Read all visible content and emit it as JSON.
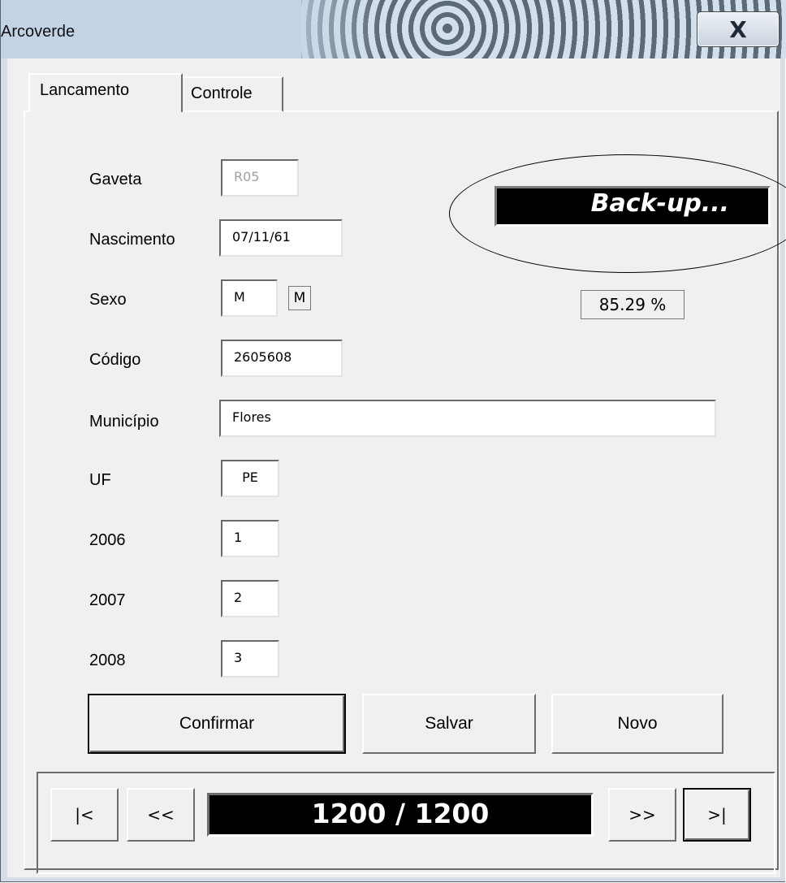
{
  "window": {
    "title": "Arcoverde",
    "close_symbol": "X"
  },
  "tabs": [
    {
      "label": "Lancamento",
      "active": true
    },
    {
      "label": "Controle",
      "active": false
    }
  ],
  "status": {
    "backup_text": "Back-up...",
    "progress_text": "85.29 %"
  },
  "form": {
    "gaveta": {
      "label": "Gaveta",
      "value": "R05"
    },
    "nascimento": {
      "label": "Nascimento",
      "value": "07/11/61"
    },
    "sexo": {
      "label": "Sexo",
      "value": "M",
      "display": "M"
    },
    "codigo": {
      "label": "Código",
      "value": "2605608"
    },
    "municipio": {
      "label": "Município",
      "value": "Flores"
    },
    "uf": {
      "label": "UF",
      "value": "PE"
    },
    "y2006": {
      "label": "2006",
      "value": "1"
    },
    "y2007": {
      "label": "2007",
      "value": "2"
    },
    "y2008": {
      "label": "2008",
      "value": "3"
    }
  },
  "buttons": {
    "confirmar": "Confirmar",
    "salvar": "Salvar",
    "novo": "Novo"
  },
  "navigation": {
    "first": "|<",
    "prev": "<<",
    "counter": "1200 / 1200",
    "next": ">>",
    "last": ">|"
  }
}
